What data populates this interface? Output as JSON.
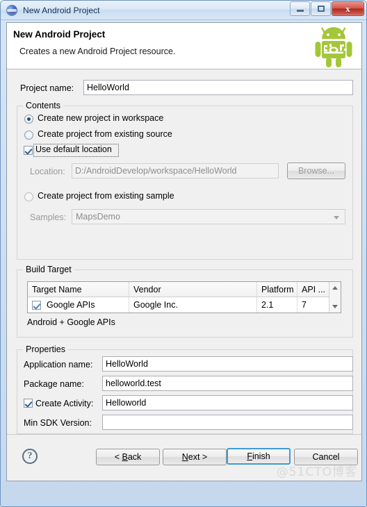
{
  "window": {
    "title": "New Android Project",
    "icon": "eclipse-sphere-icon",
    "controls": {
      "minimize": "minimize-icon",
      "maximize": "maximize-icon",
      "close": "x"
    }
  },
  "header": {
    "title": "New Android Project",
    "subtitle": "Creates a new Android Project resource.",
    "logo": "android-robot-icon"
  },
  "form": {
    "project_name_label": "Project name:",
    "project_name_value": "HelloWorld"
  },
  "contents": {
    "group_title": "Contents",
    "radio_workspace_label": "Create new project in workspace",
    "radio_existing_source_label": "Create project from existing source",
    "checkbox_default_location_label": "Use default location",
    "location_label": "Location:",
    "location_value": "D:/AndroidDevelop/workspace/HelloWorld",
    "browse_label": "Browse...",
    "radio_existing_sample_label": "Create project from existing sample",
    "samples_label": "Samples:",
    "samples_value": "MapsDemo"
  },
  "build_target": {
    "group_title": "Build Target",
    "columns": [
      "Target Name",
      "Vendor",
      "Platform",
      "API ..."
    ],
    "rows": [
      {
        "target_name": "Google APIs",
        "vendor": "Google Inc.",
        "platform": "2.1",
        "api": "7",
        "checked": true
      }
    ],
    "note": "Android + Google APIs",
    "scroll_up_icon": "triangle-up-icon",
    "scroll_down_icon": "triangle-down-icon"
  },
  "properties": {
    "group_title": "Properties",
    "application_name_label": "Application name:",
    "application_name_value": "HelloWorld",
    "package_name_label": "Package name:",
    "package_name_value": "helloworld.test",
    "create_activity_label": "Create Activity:",
    "create_activity_value": "Helloworld",
    "min_sdk_label": "Min SDK Version:",
    "min_sdk_value": ""
  },
  "footer": {
    "help_icon": "?",
    "back_label": "< Back",
    "next_label": "Next >",
    "finish_label": "Finish",
    "cancel_label": "Cancel"
  },
  "watermark": "@51CTO博客"
}
